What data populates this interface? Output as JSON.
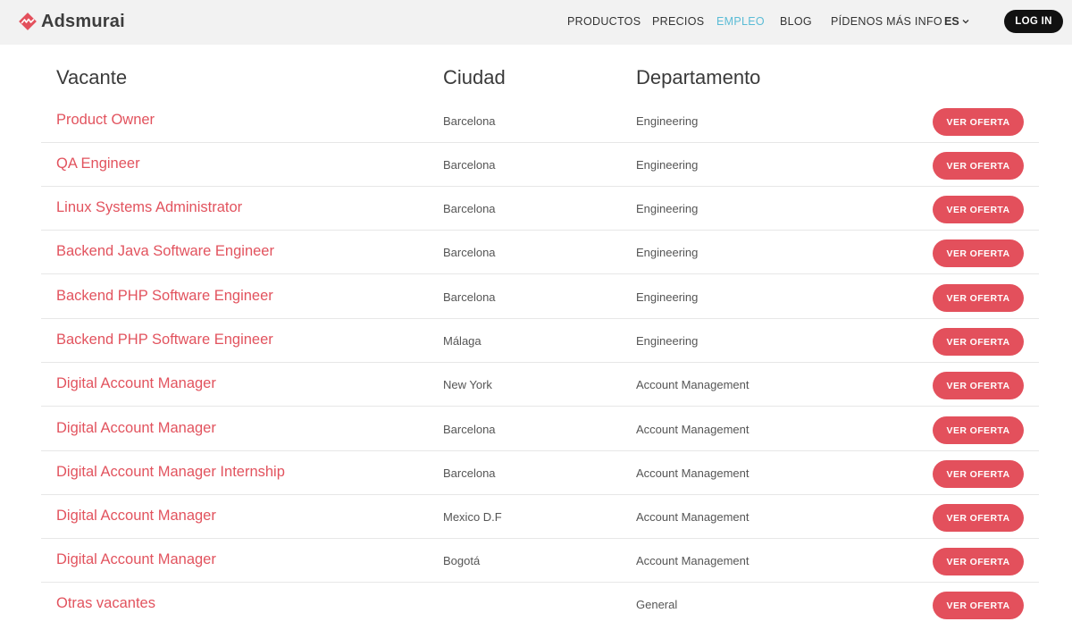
{
  "brand": {
    "name": "Adsmurai",
    "color": "#e3505c"
  },
  "nav": {
    "items": [
      "PRODUCTOS",
      "PRECIOS",
      "EMPLEO",
      "BLOG",
      "PÍDENOS MÁS INFO"
    ],
    "active": "EMPLEO",
    "language": "ES",
    "login_label": "LOG IN"
  },
  "table": {
    "headers": {
      "title": "Vacante",
      "city": "Ciudad",
      "department": "Departamento"
    },
    "button_label": "VER OFERTA",
    "rows": [
      {
        "title": "Product Owner",
        "city": "Barcelona",
        "department": "Engineering"
      },
      {
        "title": "QA Engineer",
        "city": "Barcelona",
        "department": "Engineering"
      },
      {
        "title": "Linux Systems Administrator",
        "city": "Barcelona",
        "department": "Engineering"
      },
      {
        "title": "Backend Java Software Engineer",
        "city": "Barcelona",
        "department": "Engineering"
      },
      {
        "title": "Backend PHP Software Engineer",
        "city": "Barcelona",
        "department": "Engineering"
      },
      {
        "title": "Backend PHP Software Engineer",
        "city": "Málaga",
        "department": "Engineering"
      },
      {
        "title": "Digital Account Manager",
        "city": "New York",
        "department": "Account Management"
      },
      {
        "title": "Digital Account Manager",
        "city": "Barcelona",
        "department": "Account Management"
      },
      {
        "title": "Digital Account Manager Internship",
        "city": "Barcelona",
        "department": "Account Management"
      },
      {
        "title": "Digital Account Manager",
        "city": "Mexico D.F",
        "department": "Account Management"
      },
      {
        "title": "Digital Account Manager",
        "city": "Bogotá",
        "department": "Account Management"
      },
      {
        "title": "Otras vacantes",
        "city": "",
        "department": "General"
      }
    ]
  }
}
